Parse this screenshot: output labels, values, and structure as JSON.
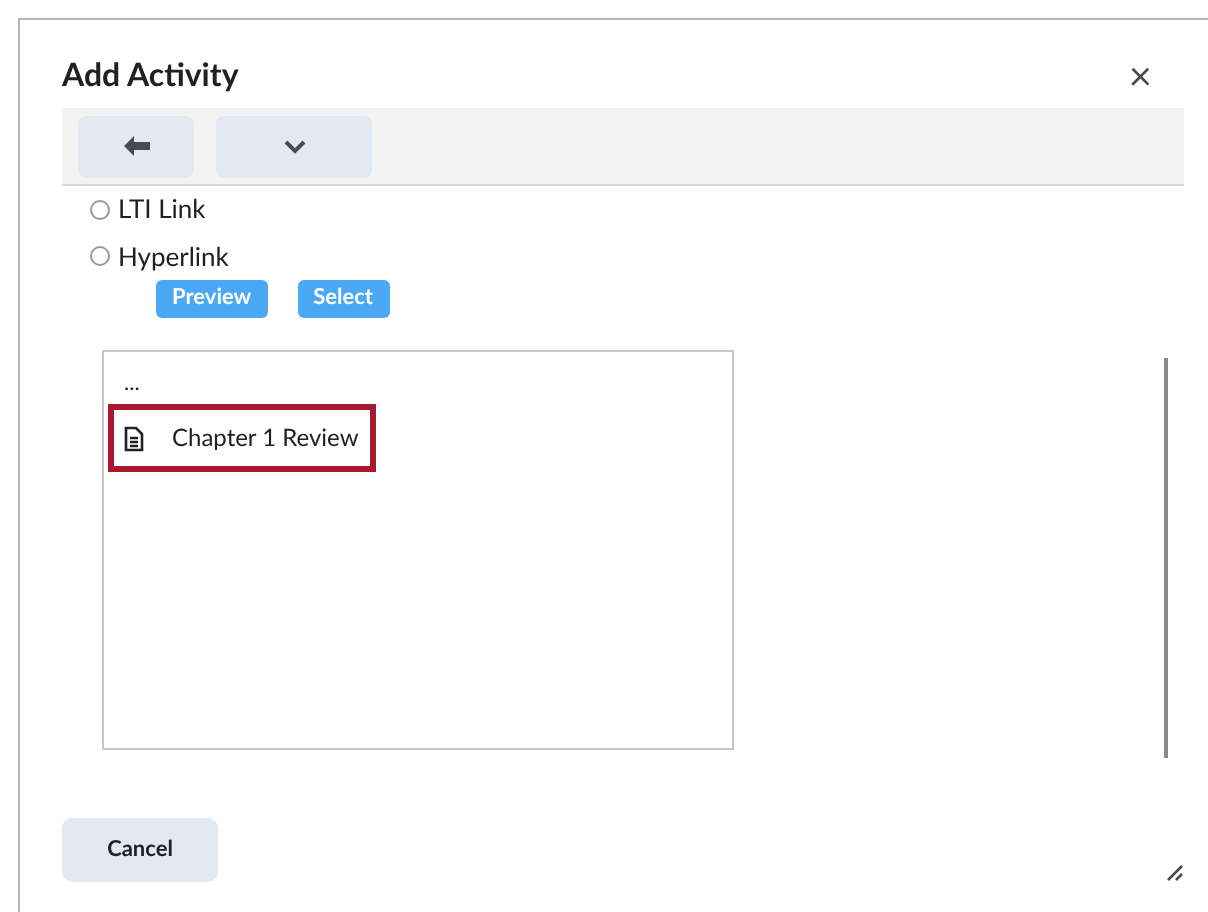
{
  "dialog": {
    "title": "Add Activity",
    "close": "×"
  },
  "options": [
    {
      "label": "LTI Link",
      "selected": false
    },
    {
      "label": "Hyperlink",
      "selected": false
    }
  ],
  "option_buttons": [
    "Preview",
    "Select"
  ],
  "list": {
    "items": [
      {
        "kind": "parent",
        "label": "..."
      },
      {
        "kind": "file",
        "label": "Chapter 1 Review",
        "selected": true
      }
    ]
  },
  "footer": {
    "cancel": "Cancel"
  }
}
